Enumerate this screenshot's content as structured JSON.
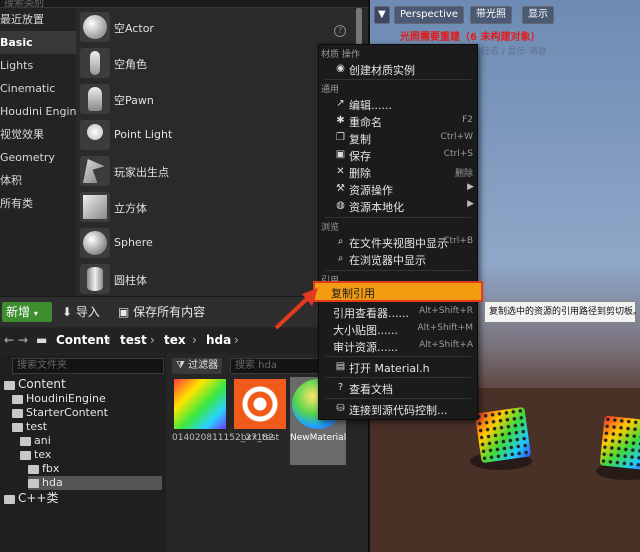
{
  "place_actors": {
    "search_placeholder": "搜索类别",
    "categories": [
      "最近放置",
      "Basic",
      "Lights",
      "Cinematic",
      "Houdini Engine",
      "视觉效果",
      "Geometry",
      "体积",
      "所有类"
    ],
    "active_category": "Basic",
    "actors": [
      "空Actor",
      "空角色",
      "空Pawn",
      "Point Light",
      "玩家出生点",
      "立方体",
      "Sphere",
      "圆柱体"
    ],
    "help_glyph": "?"
  },
  "viewport": {
    "menu_glyph": "▼",
    "perspective_label": "Perspective",
    "lit_label": "带光照",
    "show_label": "显示",
    "warning": "光照需要重建（6 未构建对象）",
    "warning_sub": "消息 日志 / 显示 消息"
  },
  "content_browser": {
    "toolbar": {
      "new_label": "新增",
      "import_label": "导入",
      "save_all_label": "保存所有内容"
    },
    "path": [
      "Content",
      "test",
      "tex",
      "hda"
    ],
    "tree_search_placeholder": "搜索文件夹",
    "tree": [
      {
        "label": "Content",
        "depth": 0
      },
      {
        "label": "HoudiniEngine",
        "depth": 1
      },
      {
        "label": "StarterContent",
        "depth": 1
      },
      {
        "label": "test",
        "depth": 1
      },
      {
        "label": "ani",
        "depth": 2
      },
      {
        "label": "tex",
        "depth": 2
      },
      {
        "label": "fbx",
        "depth": 3
      },
      {
        "label": "hda",
        "depth": 3
      },
      {
        "label": "C++类",
        "depth": 0
      }
    ],
    "selected_folder": "hda",
    "filter_label": "过滤器",
    "asset_search_placeholder": "搜索 hda",
    "assets": [
      {
        "name": "014020811152_27182",
        "kind": "texture"
      },
      {
        "name": "bxx_test",
        "kind": "hda"
      },
      {
        "name": "NewMaterial",
        "kind": "material"
      }
    ]
  },
  "context_menu": {
    "section_material": "材质 操作",
    "create_material_instance": "创建材质实例",
    "section_common": "通用",
    "edit": "编辑......",
    "rename": "重命名",
    "rename_shortcut": "F2",
    "duplicate": "复制",
    "duplicate_shortcut": "Ctrl+W",
    "save": "保存",
    "save_shortcut": "Ctrl+S",
    "delete": "删除",
    "delete_shortcut": "删除",
    "asset_actions": "资源操作",
    "asset_localization": "资源本地化",
    "section_browse": "浏览",
    "show_in_folder": "在文件夹视图中显示",
    "show_in_folder_shortcut": "Ctrl+B",
    "show_in_explorer": "在浏览器中显示",
    "section_references": "引用",
    "copy_reference": "复制引用",
    "reference_viewer": "引用查看器......",
    "reference_viewer_shortcut": "Alt+Shift+R",
    "size_map": "大小贴图......",
    "size_map_shortcut": "Alt+Shift+M",
    "audit_assets": "审计资源......",
    "audit_assets_shortcut": "Alt+Shift+A",
    "open_material_h": "打开 Material.h",
    "view_docs": "查看文档",
    "connect_source_control": "连接到源代码控制..."
  },
  "tooltip": "复制选中的资源的引用路径到剪切板。",
  "colors": {
    "highlight": "#f39c12",
    "highlight_border": "#e23a1f",
    "new_button": "#3e8d2f",
    "warning": "#e31b1b"
  }
}
